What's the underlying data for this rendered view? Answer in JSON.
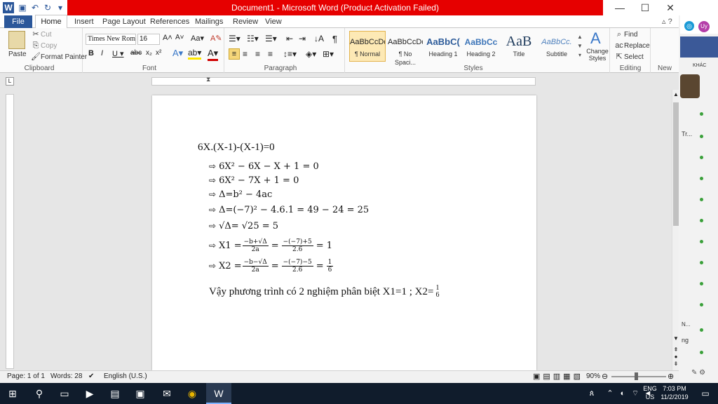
{
  "window": {
    "title": "Document1 - Microsoft Word (Product Activation Failed)"
  },
  "tabs": [
    "File",
    "Home",
    "Insert",
    "Page Layout",
    "References",
    "Mailings",
    "Review",
    "View"
  ],
  "clipboard": {
    "paste": "Paste",
    "cut": "Cut",
    "copy": "Copy",
    "format_painter": "Format Painter",
    "label": "Clipboard"
  },
  "font": {
    "name": "Times New Rom",
    "size": "16",
    "label": "Font"
  },
  "paragraph": {
    "label": "Paragraph"
  },
  "styles": {
    "label": "Styles",
    "items": [
      {
        "preview": "AaBbCcDc",
        "name": "¶ Normal"
      },
      {
        "preview": "AaBbCcDc",
        "name": "¶ No Spaci..."
      },
      {
        "preview": "AaBbC(",
        "name": "Heading 1"
      },
      {
        "preview": "AaBbCc",
        "name": "Heading 2"
      },
      {
        "preview": "AaB",
        "name": "Title"
      },
      {
        "preview": "AaBbCc.",
        "name": "Subtitle"
      }
    ],
    "change": "Change Styles"
  },
  "editing": {
    "find": "Find",
    "replace": "Replace",
    "select": "Select",
    "label": "Editing"
  },
  "newgroup": {
    "label": "New Gr..."
  },
  "document": {
    "line0": "6X.(X-1)-(X-1)=0",
    "line1": "6X² − 6X − X + 1 = 0",
    "line2": "6X² − 7X + 1 = 0",
    "line3": "Δ=b² − 4ac",
    "line4": "Δ=(−7)² − 4.6.1 = 49 − 24 = 25",
    "line5": "√Δ= √25 = 5",
    "x1_lhs": "X1 =",
    "x1_n1": "−b+√Δ",
    "x1_d1": "2a",
    "x1_n2": "−(−7)+5",
    "x1_d2": "2.6",
    "x1_res": "= 1",
    "x2_lhs": "X2 =",
    "x2_n1": "−b−√Δ",
    "x2_d1": "2a",
    "x2_n2": "−(−7)−5",
    "x2_d2": "2.6",
    "x2_rn": "1",
    "x2_rd": "6",
    "conclusion": "Vậy phương trình có 2 nghiệm phân biệt X1=1 ; X2=",
    "conc_n": "1",
    "conc_d": "6"
  },
  "status": {
    "page": "Page: 1 of 1",
    "words": "Words: 28",
    "language": "English (U.S.)",
    "zoom": "90%",
    "zoom_fraction": 0.45
  },
  "rightpanel": {
    "user": "Uy",
    "khac": "KHÁC",
    "tr": "Tr...",
    "n": "N...",
    "ng": "ng"
  },
  "taskbar": {
    "lang1": "ENG",
    "lang2": "US",
    "time": "7:03 PM",
    "date": "11/2/2019"
  }
}
